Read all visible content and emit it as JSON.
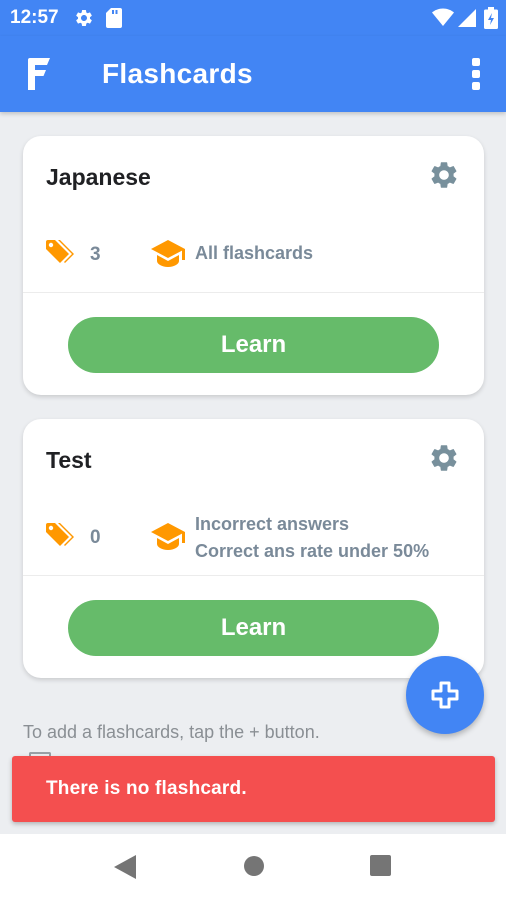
{
  "status_bar": {
    "time": "12:57",
    "icons": [
      "gear-icon",
      "sd-card-icon",
      "wifi-icon",
      "signal-icon",
      "battery-icon"
    ]
  },
  "app_bar": {
    "logo_icon": "flashcards-logo",
    "title": "Flashcards",
    "menu_icon": "more-vert-icon"
  },
  "decks": [
    {
      "name": "Japanese",
      "tag_count": "3",
      "conditions": [
        "All flashcards"
      ],
      "learn_label": "Learn"
    },
    {
      "name": "Test",
      "tag_count": "0",
      "conditions": [
        "Incorrect answers",
        "Correct ans rate under 50%"
      ],
      "learn_label": "Learn"
    }
  ],
  "hint_text": "To add a flashcards, tap the + button.",
  "fab": {
    "icon": "add-icon"
  },
  "snackbar": {
    "message": "There is no flashcard."
  },
  "nav_bar": {
    "icons": [
      "back-icon",
      "home-icon",
      "recents-icon"
    ]
  },
  "colors": {
    "primary": "#4285f4",
    "learn_button": "#66bb6a",
    "accent_orange": "#ff9800",
    "snackbar": "#f44f4f",
    "gear_gray": "#78909c",
    "meta_text": "#7a8a99",
    "background": "#eceef1"
  }
}
